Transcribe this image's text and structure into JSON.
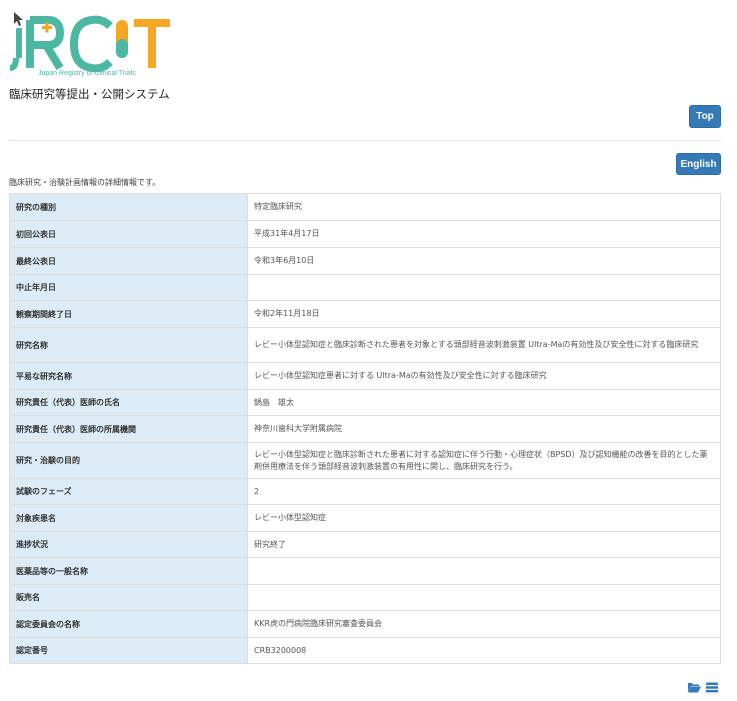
{
  "header": {
    "logo_text": "Japan Registry of Clinical Trials",
    "system_title": "臨床研究等提出・公開システム"
  },
  "buttons": {
    "top": "Top",
    "english": "English"
  },
  "intro": "臨床研究・治験計画情報の詳細情報です。",
  "rows": [
    {
      "label": "研究の種別",
      "value": "特定臨床研究"
    },
    {
      "label": "初回公表日",
      "value": "平成31年4月17日"
    },
    {
      "label": "最終公表日",
      "value": "令和3年6月10日"
    },
    {
      "label": "中止年月日",
      "value": ""
    },
    {
      "label": "観察期間終了日",
      "value": "令和2年11月18日"
    },
    {
      "label": "研究名称",
      "value": "レビー小体型認知症と臨床診断された患者を対象とする頭部経音波刺激装置 Ultra-Maの有効性及び安全性に対する臨床研究"
    },
    {
      "label": "平易な研究名称",
      "value": "レビー小体型認知症患者に対する Ultra-Maの有効性及び安全性に対する臨床研究"
    },
    {
      "label": "研究責任（代表）医師の氏名",
      "value": "鍋島　雄太"
    },
    {
      "label": "研究責任（代表）医師の所属機関",
      "value": "神奈川歯科大学附属病院"
    },
    {
      "label": "研究・治験の目的",
      "value": "レビー小体型認知症と臨床診断された患者に対する認知症に伴う行動・心理症状（BPSD）及び認知機能の改善を目的とした薬剤併用療法を伴う頭部経音波刺激装置の有用性に関し、臨床研究を行う。"
    },
    {
      "label": "試験のフェーズ",
      "value": "2"
    },
    {
      "label": "対象疾患名",
      "value": "レビー小体型認知症"
    },
    {
      "label": "進捗状況",
      "value": "研究終了"
    },
    {
      "label": "医薬品等の一般名称",
      "value": ""
    },
    {
      "label": "販売名",
      "value": ""
    },
    {
      "label": "認定委員会の名称",
      "value": "KKR虎の門病院臨床研究審査委員会"
    },
    {
      "label": "認定番号",
      "value": "CRB3200008"
    }
  ],
  "footer_icons": [
    "folder-open-icon",
    "list-icon"
  ],
  "colors": {
    "accent": "#337ab7",
    "label_bg": "#dcebf6",
    "logo_teal": "#4cb8a4",
    "logo_orange": "#f5a623"
  }
}
